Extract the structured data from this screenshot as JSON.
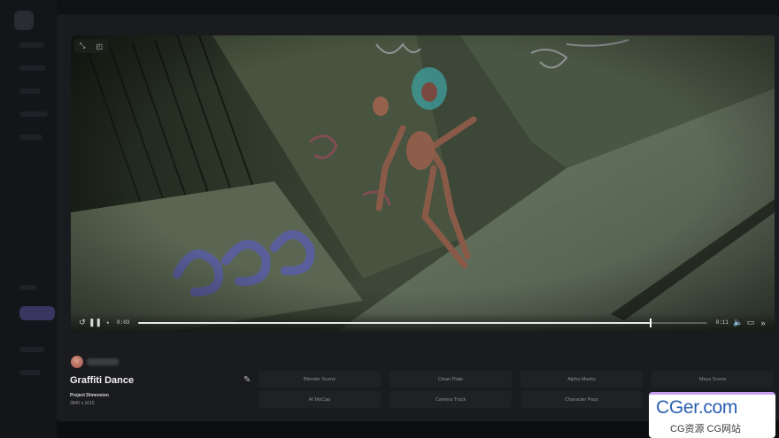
{
  "player": {
    "current_time": "0:03",
    "duration": "0:11",
    "progress": 0.9
  },
  "project": {
    "title": "Graffiti Dance",
    "dimension_label": "Project Dimension",
    "dimension_value": "3840 x 1610"
  },
  "assets": [
    {
      "label": "Blender Scene"
    },
    {
      "label": "Clean Plate"
    },
    {
      "label": "Alpha Masks"
    },
    {
      "label": "Maya Scene"
    },
    {
      "label": "AI MoCap"
    },
    {
      "label": "Camera Track"
    },
    {
      "label": "Character Pass"
    }
  ],
  "watermark": {
    "main": "CGer.com",
    "sub": "CG资源 CG网站"
  },
  "icons": {
    "expand": "expand-icon",
    "camera": "camera-icon",
    "replay": "replay-icon",
    "pause": "pause-icon",
    "speed": "speed-icon",
    "volume": "volume-icon",
    "cast": "cast-icon",
    "forward": "forward-icon",
    "edit": "pencil-icon"
  }
}
